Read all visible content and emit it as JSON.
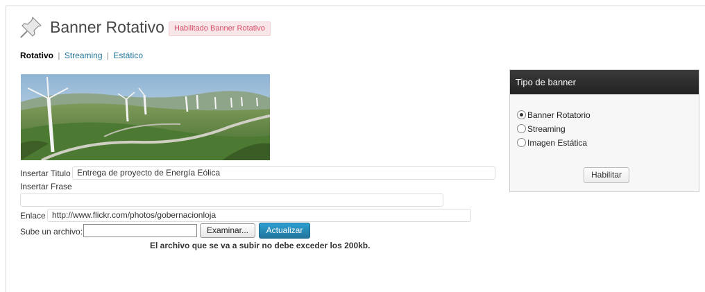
{
  "header": {
    "title": "Banner Rotativo",
    "status_badge": "Habilitado Banner Rotativo",
    "icon": "pushpin-icon"
  },
  "subnav": {
    "items": [
      {
        "label": "Rotativo",
        "current": true
      },
      {
        "label": "Streaming",
        "current": false
      },
      {
        "label": "Estático",
        "current": false
      }
    ],
    "separator": "|"
  },
  "form": {
    "titulo": {
      "label": "Insertar Titulo",
      "value": "Entrega de proyecto de Energía Eólica"
    },
    "frase": {
      "label": "Insertar Frase",
      "value": ""
    },
    "enlace": {
      "label": "Enlace",
      "value": "http://www.flickr.com/photos/gobernacionloja"
    },
    "archivo": {
      "label": "Sube un archivo:",
      "browse_label": "Examinar...",
      "submit_label": "Actualizar"
    },
    "note": "El archivo que se va a subir no debe exceder los 200kb."
  },
  "panel": {
    "title": "Tipo de banner",
    "options": [
      {
        "label": "Banner Rotatorio",
        "checked": true
      },
      {
        "label": "Streaming",
        "checked": false
      },
      {
        "label": "Imagen Estática",
        "checked": false
      }
    ],
    "button_label": "Habilitar"
  },
  "colors": {
    "accent": "#21759b",
    "badge_text": "#d54e67",
    "badge_bg": "#f9e6e8",
    "panel_header": "#2b2b2b"
  }
}
